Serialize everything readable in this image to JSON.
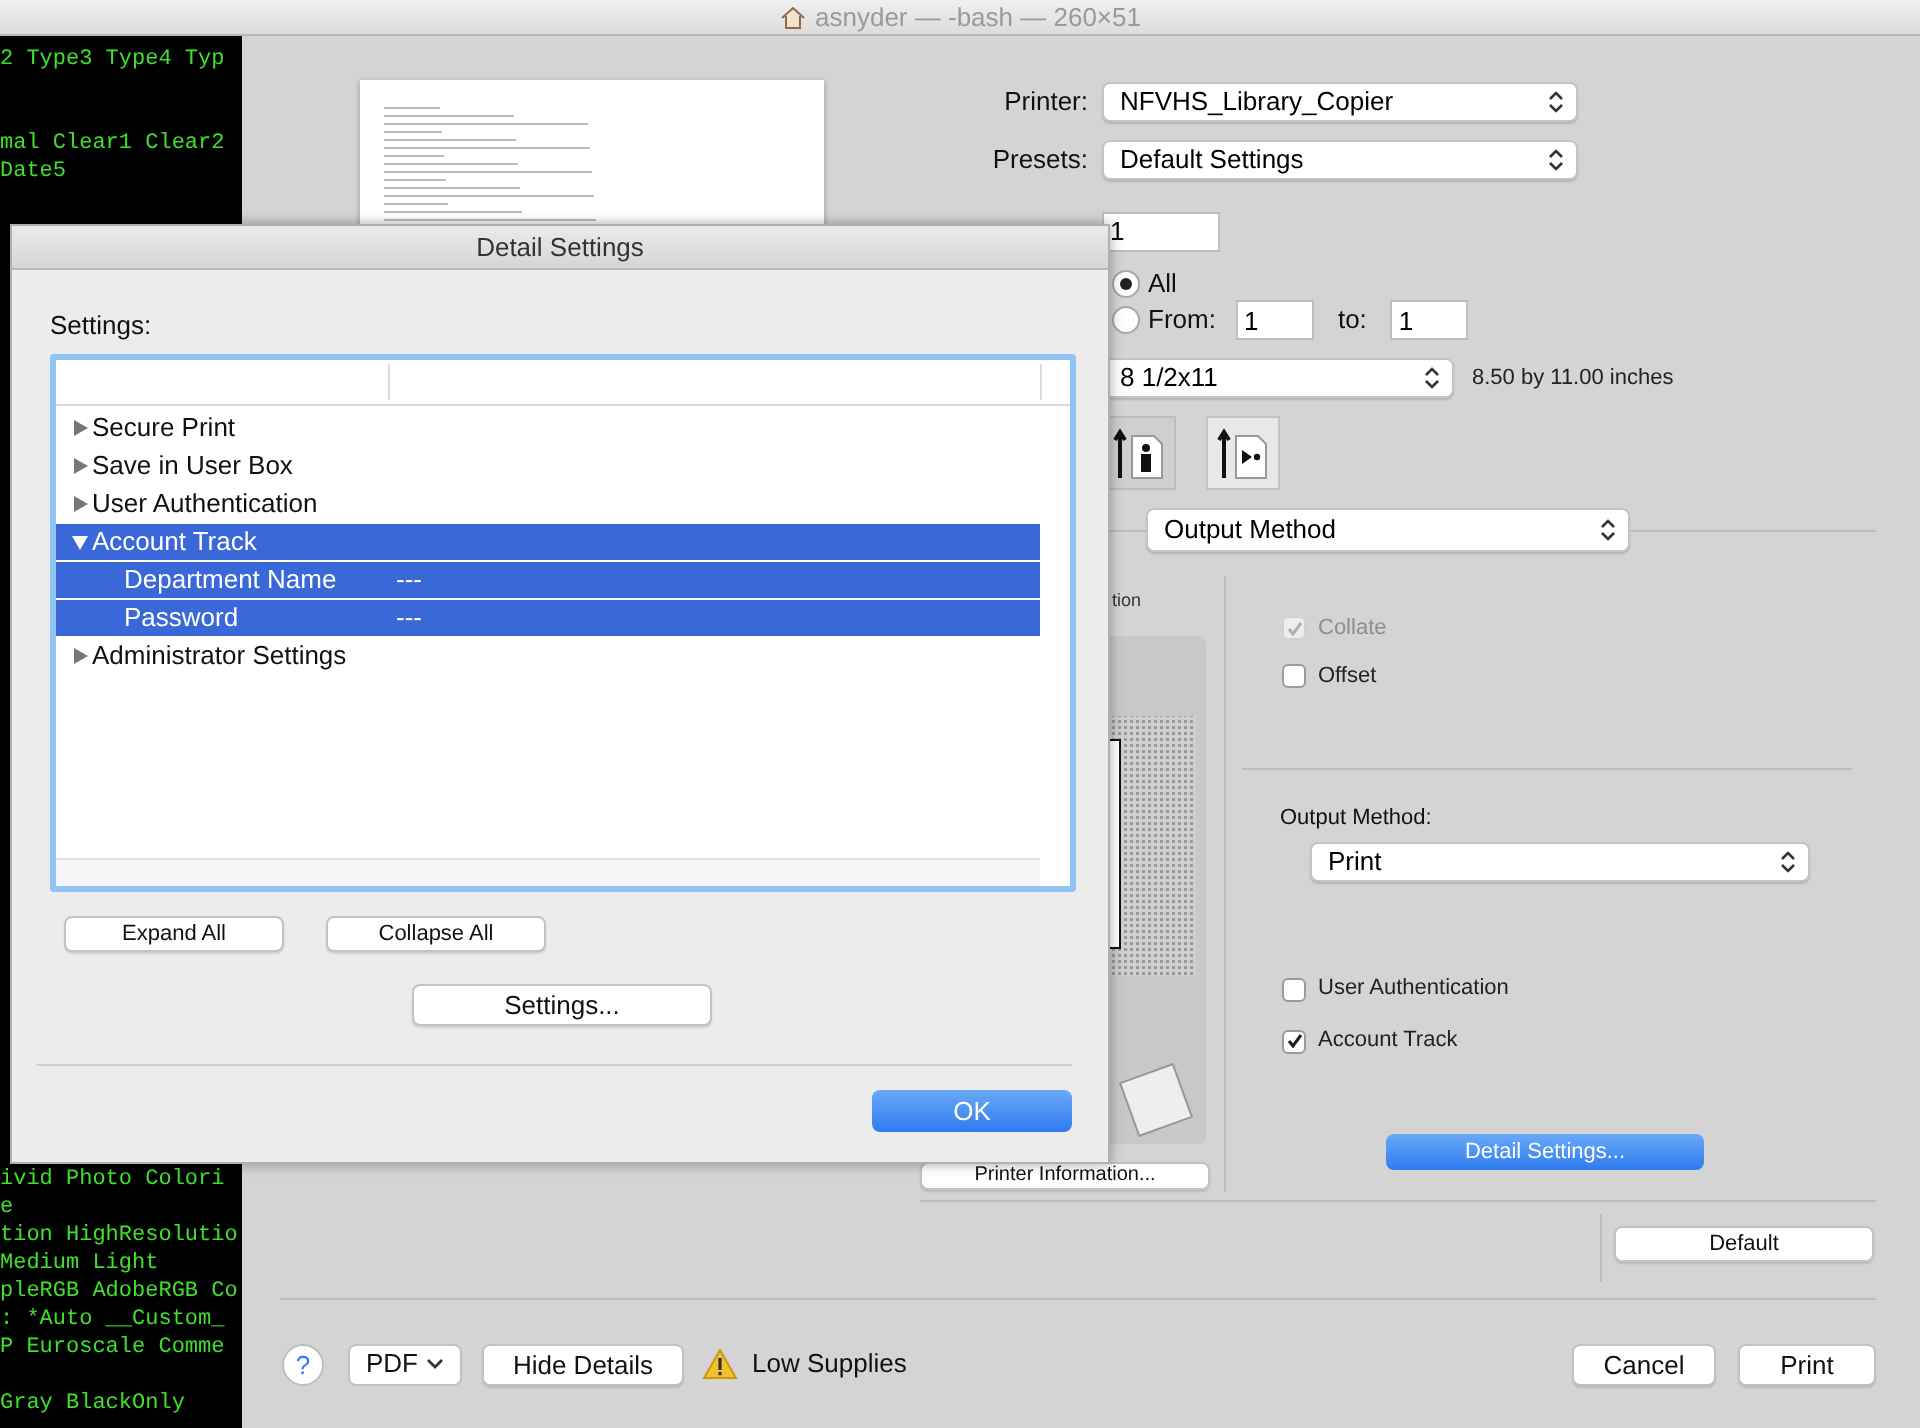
{
  "terminal": {
    "title": "asnyder — -bash — 260×51",
    "blocks": [
      [
        "2 Type3 Type4 Typ"
      ],
      [
        "mal Clear1 Clear2",
        "Date5"
      ],
      [
        "ivid Photo Colori",
        "e",
        "tion HighResolutio",
        "Medium Light",
        "pleRGB AdobeRGB Co",
        ": *Auto __Custom_",
        "P Euroscale Comme"
      ],
      [
        "Gray BlackOnly"
      ]
    ]
  },
  "print_sheet": {
    "printer": {
      "label": "Printer:",
      "value": "NFVHS_Library_Copier"
    },
    "presets": {
      "label": "Presets:",
      "value": "Default Settings"
    },
    "copies": {
      "value": "1"
    },
    "pages": {
      "options": [
        {
          "label": "All",
          "selected": true
        },
        {
          "label": "From:",
          "selected": false
        }
      ],
      "from": "1",
      "to_label": "to:",
      "to": "1"
    },
    "paper_size": {
      "value": "8 1/2x11",
      "dimensions": "8.50 by 11.00 inches"
    },
    "section": {
      "value": "Output Method"
    },
    "preview_label": "tion",
    "printer_info_button": "Printer Information...",
    "checkboxes_top": [
      {
        "label": "Collate",
        "checked": true,
        "disabled": true
      },
      {
        "label": "Offset",
        "checked": false,
        "disabled": false
      }
    ],
    "output_method": {
      "label": "Output Method:",
      "value": "Print"
    },
    "checkboxes_bottom": [
      {
        "label": "User Authentication",
        "checked": false,
        "disabled": false
      },
      {
        "label": "Account Track",
        "checked": true,
        "disabled": false
      }
    ],
    "detail_settings_button": "Detail Settings...",
    "default_button": "Default",
    "bottom_bar": {
      "help": "?",
      "pdf": "PDF",
      "hide_details": "Hide Details",
      "warning": "Low Supplies",
      "cancel": "Cancel",
      "print": "Print"
    }
  },
  "dialog": {
    "title": "Detail Settings",
    "settings_label": "Settings:",
    "tree": [
      {
        "label": "Secure Print",
        "expanded": false,
        "selected": false
      },
      {
        "label": "Save in User Box",
        "expanded": false,
        "selected": false
      },
      {
        "label": "User Authentication",
        "expanded": false,
        "selected": false
      },
      {
        "label": "Account Track",
        "expanded": true,
        "selected": true,
        "children": [
          {
            "label": "Department Name",
            "value": "---",
            "selected": true
          },
          {
            "label": "Password",
            "value": "---",
            "selected": true
          }
        ]
      },
      {
        "label": "Administrator Settings",
        "expanded": false,
        "selected": false
      }
    ],
    "expand_all": "Expand All",
    "collapse_all": "Collapse All",
    "settings_button": "Settings...",
    "ok": "OK"
  }
}
